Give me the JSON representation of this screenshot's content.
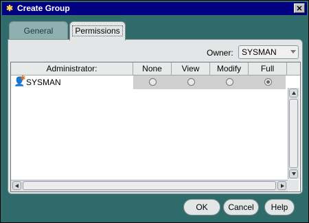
{
  "window": {
    "title": "Create Group",
    "close_glyph": "✕"
  },
  "tabs": [
    {
      "label": "General"
    },
    {
      "label": "Permissions"
    }
  ],
  "owner": {
    "label": "Owner:",
    "value": "SYSMAN"
  },
  "table": {
    "columns": [
      "Administrator:",
      "None",
      "View",
      "Modify",
      "Full"
    ],
    "rows": [
      {
        "administrator": "SYSMAN",
        "permission": "Full"
      }
    ]
  },
  "buttons": {
    "ok": "OK",
    "cancel": "Cancel",
    "help": "Help"
  }
}
